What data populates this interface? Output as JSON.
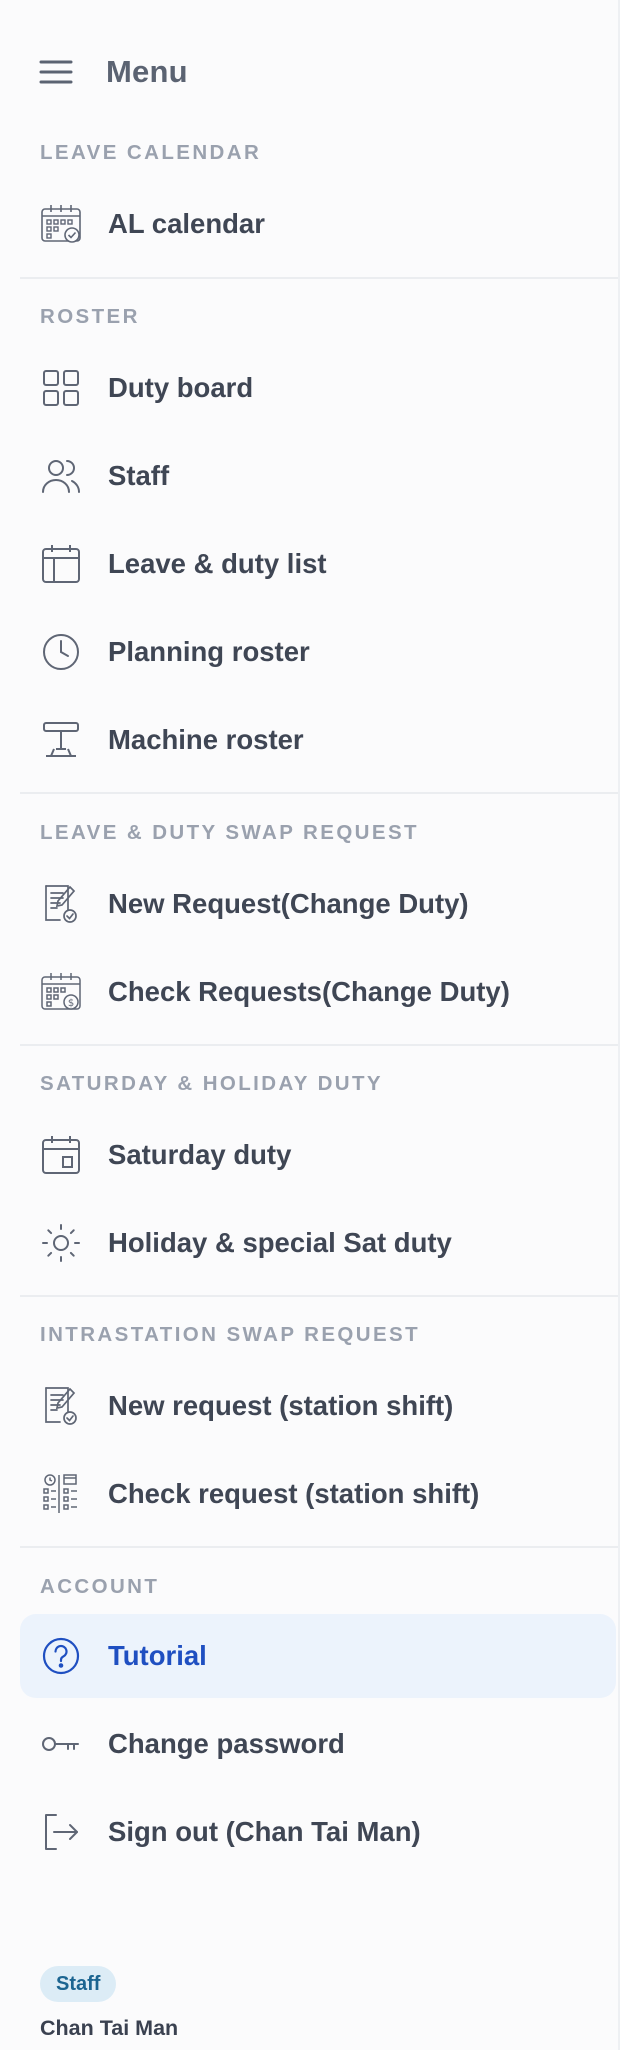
{
  "header": {
    "title": "Menu",
    "menu_icon": "hamburger-icon"
  },
  "sections": {
    "leave_calendar": {
      "heading": "LEAVE CALENDAR",
      "items": [
        {
          "label": "AL calendar",
          "icon": "calendar-check-icon"
        }
      ]
    },
    "roster": {
      "heading": "ROSTER",
      "items": [
        {
          "label": "Duty board",
          "icon": "grid-icon"
        },
        {
          "label": "Staff",
          "icon": "users-icon"
        },
        {
          "label": "Leave & duty list",
          "icon": "calendar-list-icon"
        },
        {
          "label": "Planning roster",
          "icon": "clock-icon"
        },
        {
          "label": "Machine roster",
          "icon": "machine-icon"
        }
      ]
    },
    "swap_request": {
      "heading": "LEAVE & DUTY SWAP REQUEST",
      "items": [
        {
          "label": "New Request(Change Duty)",
          "icon": "document-edit-icon"
        },
        {
          "label": "Check Requests(Change Duty)",
          "icon": "calendar-money-icon"
        }
      ]
    },
    "saturday_holiday": {
      "heading": "SATURDAY & HOLIDAY DUTY",
      "items": [
        {
          "label": "Saturday duty",
          "icon": "calendar-day-icon"
        },
        {
          "label": "Holiday & special Sat duty",
          "icon": "sun-icon"
        }
      ]
    },
    "intrastation": {
      "heading": "INTRASTATION SWAP REQUEST",
      "items": [
        {
          "label": "New request (station shift)",
          "icon": "document-edit-icon"
        },
        {
          "label": "Check request (station shift)",
          "icon": "schedule-list-icon"
        }
      ]
    },
    "account": {
      "heading": "ACCOUNT",
      "items": [
        {
          "label": "Tutorial",
          "icon": "question-circle-icon",
          "active": true
        },
        {
          "label": "Change password",
          "icon": "key-icon"
        },
        {
          "label": "Sign out (Chan Tai Man)",
          "icon": "sign-out-icon"
        }
      ]
    }
  },
  "footer": {
    "role_badge": "Staff",
    "user_name": "Chan Tai Man"
  },
  "colors": {
    "active_bg": "#ecf3fc",
    "active_text": "#1f4fc1",
    "section_heading": "#9aa1ae",
    "item_text": "#3f4654",
    "badge_bg": "#dcecf6",
    "badge_text": "#1c6591"
  }
}
